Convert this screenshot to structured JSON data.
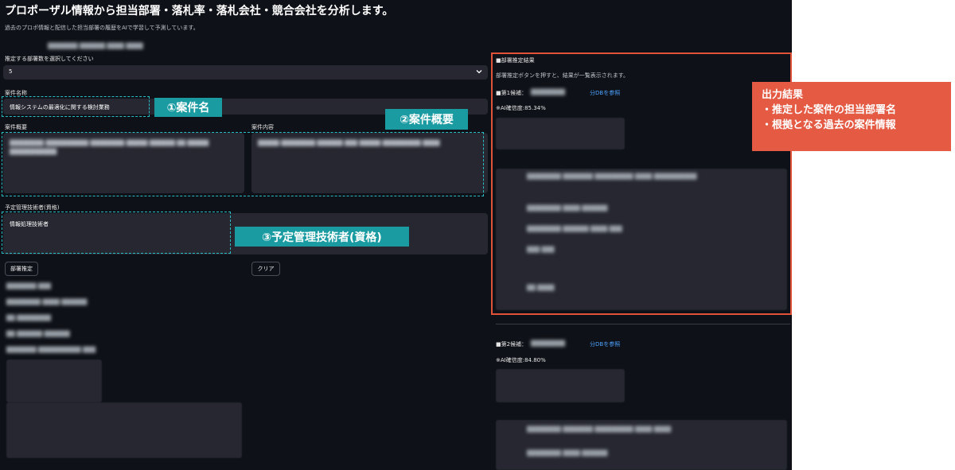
{
  "header": {
    "title": "プロポーザル情報から担当部署・落札率・落札会社・競合会社を分析します。",
    "subtitle": "過去のプロポ情報と配信した担当部署の履歴をAIで学習して予測しています。"
  },
  "form": {
    "dept_count_label": "推定する部署数を選択してください",
    "dept_count_value": "5",
    "project_name_label": "案件名称",
    "project_name_value": "情報システムの最適化に関する検討業務",
    "summary_label": "案件概要",
    "content_label": "案件内容",
    "engineer_label": "予定管理技術者(資格)",
    "engineer_value": "情報処理技術者",
    "estimate_button": "部署推定",
    "clear_button": "クリア"
  },
  "annotations": {
    "callout1": "①案件名",
    "callout2": "②案件概要",
    "callout3": "③予定管理技術者(資格)",
    "output_panel_lines": [
      "出力結果",
      "・推定した案件の担当部署名",
      "・根拠となる過去の案件情報"
    ]
  },
  "results": {
    "heading": "■部署推定結果",
    "hint": "部署推定ボタンを押すと、結果が一覧表示されます。",
    "candidate1_label": "■第1候補：",
    "candidate1_link": "分DBを参照",
    "candidate1_confidence": "※AI確信度:85.34%",
    "candidate2_label": "■第2候補：",
    "candidate2_link": "分DBを参照",
    "candidate2_confidence": "※AI確信度:84.80%"
  },
  "colors": {
    "app_bg": "#0e1117",
    "input_bg": "#262730",
    "callout_teal": "#1a9ba2",
    "dash_teal": "#2bbcc4",
    "output_red": "#e45a43",
    "link_blue": "#4da3ff"
  }
}
